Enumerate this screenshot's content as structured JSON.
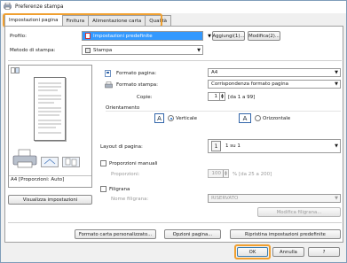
{
  "window": {
    "title": "Preferenze stampa"
  },
  "tabs": [
    "Impostazioni pagina",
    "Finitura",
    "Alimentazione carta",
    "Qualità"
  ],
  "profile": {
    "label": "Profilo:",
    "value": "Impostazioni predefinite",
    "add_button": "Aggiungi(1)...",
    "edit_button": "Modifica(2)..."
  },
  "output_method": {
    "label": "Metodo di stampa:",
    "value": "Stampa"
  },
  "preview": {
    "caption": "A4 [Proporzioni: Auto]",
    "view_settings_button": "Visualizza impostazioni"
  },
  "page_format": {
    "label": "Formato pagina:",
    "value": "A4"
  },
  "print_format": {
    "label": "Formato stampa:",
    "value": "Corrispondenza formato pagina"
  },
  "copies": {
    "label": "Copie:",
    "value": "1",
    "range": "[da 1 a 99]"
  },
  "orientation": {
    "label": "Orientamento",
    "portrait": "Verticale",
    "landscape": "Orizzontale",
    "portrait_letter": "A",
    "landscape_letter": "A",
    "selected": "portrait"
  },
  "layout": {
    "label": "Layout di pagina:",
    "value": "1 su 1",
    "icon_number": "1"
  },
  "manual_scaling": {
    "label": "Proporzioni manuali",
    "sub_label": "Proporzioni:",
    "value": "100",
    "range": "% [da 25 a 200]"
  },
  "watermark": {
    "label": "Filigrana",
    "name_label": "Nome filigrana:",
    "value": "RISERVATO",
    "edit_button": "Modifica filigrana..."
  },
  "bottom_buttons": {
    "custom_paper": "Formato carta personalizzato...",
    "page_options": "Opzioni pagina...",
    "restore_defaults": "Ripristina impostazioni predefinite"
  },
  "dialog_buttons": {
    "ok": "OK",
    "cancel": "Annulla",
    "help": "?"
  }
}
